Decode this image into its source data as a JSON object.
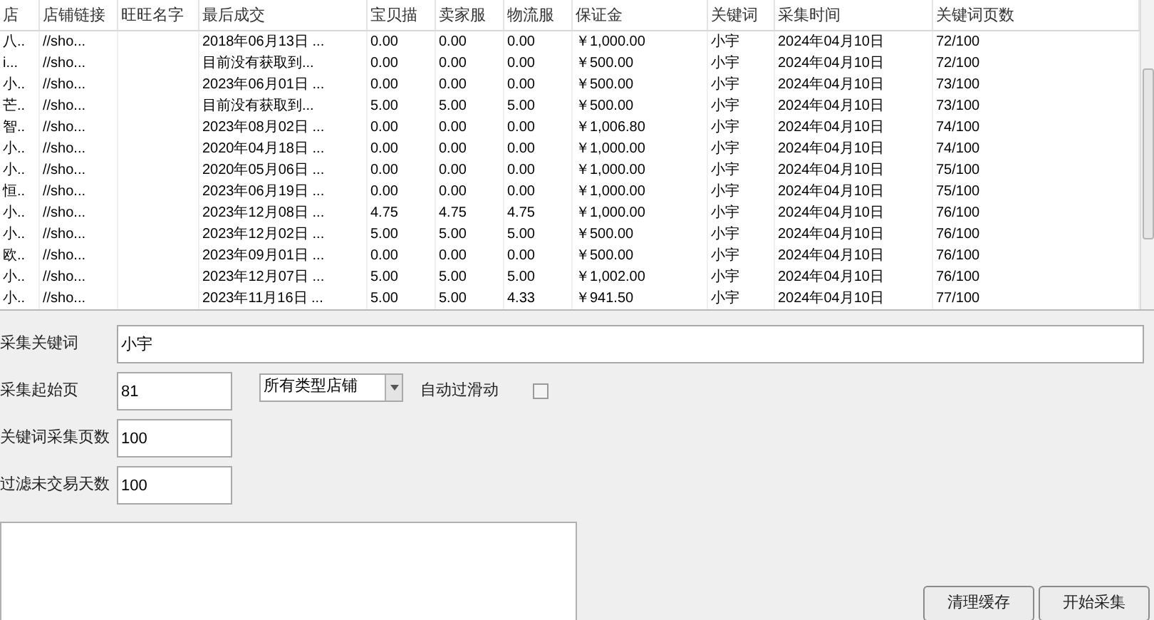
{
  "table": {
    "columns": [
      {
        "label": "店"
      },
      {
        "label": "店铺链接"
      },
      {
        "label": "旺旺名字"
      },
      {
        "label": "最后成交"
      },
      {
        "label": "宝贝描"
      },
      {
        "label": "卖家服"
      },
      {
        "label": "物流服"
      },
      {
        "label": "保证金"
      },
      {
        "label": "关键词"
      },
      {
        "label": "采集时间"
      },
      {
        "label": "关键词页数"
      }
    ],
    "rows": [
      {
        "store": "八..",
        "link": "//sho...",
        "last_deal": "2018年06月13日 ...",
        "desc": "0.00",
        "service": "0.00",
        "logistics": "0.00",
        "deposit": "￥1,000.00",
        "keyword": "小宇",
        "time": "2024年04月10日",
        "pages": "72/100"
      },
      {
        "store": "i...",
        "link": "//sho...",
        "last_deal": "目前没有获取到...",
        "desc": "0.00",
        "service": "0.00",
        "logistics": "0.00",
        "deposit": "￥500.00",
        "keyword": "小宇",
        "time": "2024年04月10日",
        "pages": "72/100"
      },
      {
        "store": "小..",
        "link": "//sho...",
        "last_deal": "2023年06月01日 ...",
        "desc": "0.00",
        "service": "0.00",
        "logistics": "0.00",
        "deposit": "￥500.00",
        "keyword": "小宇",
        "time": "2024年04月10日",
        "pages": "73/100"
      },
      {
        "store": "芒..",
        "link": "//sho...",
        "last_deal": "目前没有获取到...",
        "desc": "5.00",
        "service": "5.00",
        "logistics": "5.00",
        "deposit": "￥500.00",
        "keyword": "小宇",
        "time": "2024年04月10日",
        "pages": "73/100"
      },
      {
        "store": "智..",
        "link": "//sho...",
        "last_deal": "2023年08月02日 ...",
        "desc": "0.00",
        "service": "0.00",
        "logistics": "0.00",
        "deposit": "￥1,006.80",
        "keyword": "小宇",
        "time": "2024年04月10日",
        "pages": "74/100"
      },
      {
        "store": "小..",
        "link": "//sho...",
        "last_deal": "2020年04月18日 ...",
        "desc": "0.00",
        "service": "0.00",
        "logistics": "0.00",
        "deposit": "￥1,000.00",
        "keyword": "小宇",
        "time": "2024年04月10日",
        "pages": "74/100"
      },
      {
        "store": "小..",
        "link": "//sho...",
        "last_deal": "2020年05月06日 ...",
        "desc": "0.00",
        "service": "0.00",
        "logistics": "0.00",
        "deposit": "￥1,000.00",
        "keyword": "小宇",
        "time": "2024年04月10日",
        "pages": "75/100"
      },
      {
        "store": "恒..",
        "link": "//sho...",
        "last_deal": "2023年06月19日 ...",
        "desc": "0.00",
        "service": "0.00",
        "logistics": "0.00",
        "deposit": "￥1,000.00",
        "keyword": "小宇",
        "time": "2024年04月10日",
        "pages": "75/100"
      },
      {
        "store": "小..",
        "link": "//sho...",
        "last_deal": "2023年12月08日 ...",
        "desc": "4.75",
        "service": "4.75",
        "logistics": "4.75",
        "deposit": "￥1,000.00",
        "keyword": "小宇",
        "time": "2024年04月10日",
        "pages": "76/100"
      },
      {
        "store": "小..",
        "link": "//sho...",
        "last_deal": "2023年12月02日 ...",
        "desc": "5.00",
        "service": "5.00",
        "logistics": "5.00",
        "deposit": "￥500.00",
        "keyword": "小宇",
        "time": "2024年04月10日",
        "pages": "76/100"
      },
      {
        "store": "欧..",
        "link": "//sho...",
        "last_deal": "2023年09月01日 ...",
        "desc": "0.00",
        "service": "0.00",
        "logistics": "0.00",
        "deposit": "￥500.00",
        "keyword": "小宇",
        "time": "2024年04月10日",
        "pages": "76/100"
      },
      {
        "store": "小..",
        "link": "//sho...",
        "last_deal": "2023年12月07日 ...",
        "desc": "5.00",
        "service": "5.00",
        "logistics": "5.00",
        "deposit": "￥1,002.00",
        "keyword": "小宇",
        "time": "2024年04月10日",
        "pages": "76/100"
      },
      {
        "store": "小..",
        "link": "//sho...",
        "last_deal": "2023年11月16日 ...",
        "desc": "5.00",
        "service": "5.00",
        "logistics": "4.33",
        "deposit": "￥941.50",
        "keyword": "小宇",
        "time": "2024年04月10日",
        "pages": "77/100"
      }
    ]
  },
  "form": {
    "keyword": {
      "label": "采集关键词",
      "value": "小宇"
    },
    "start_page": {
      "label": "采集起始页",
      "value": "81"
    },
    "shop_type": {
      "value": "所有类型店铺"
    },
    "auto_slide": {
      "label": "自动过滑动",
      "checked": false
    },
    "page_count": {
      "label": "关键词采集页数",
      "value": "100"
    },
    "filter_days": {
      "label": "过滤未交易天数",
      "value": "100"
    }
  },
  "buttons": [
    {
      "label": "清理缓存"
    },
    {
      "label": "开始采集"
    }
  ]
}
